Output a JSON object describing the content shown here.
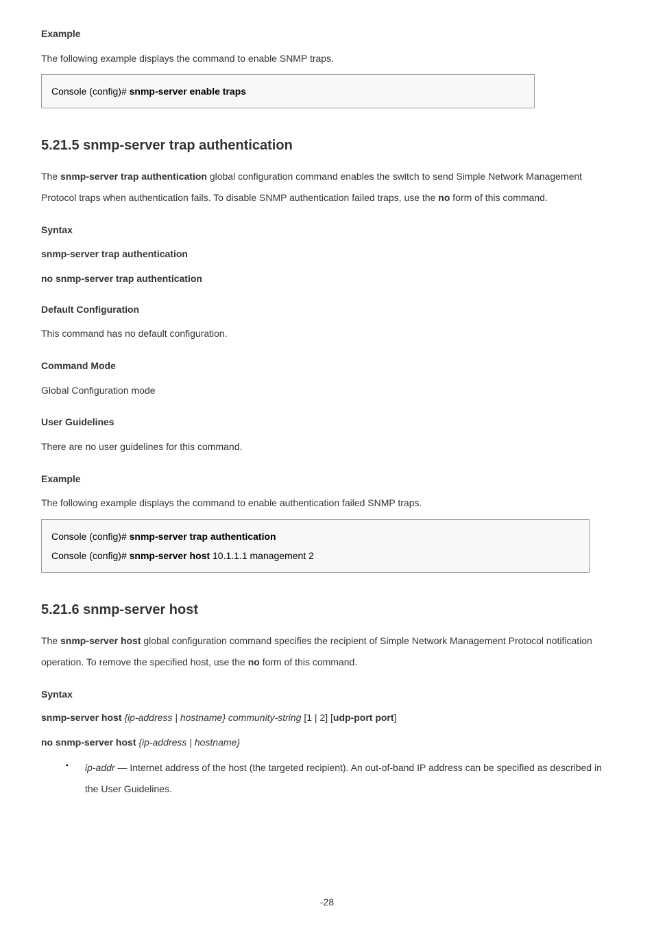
{
  "top": {
    "example_label": "Example",
    "example_intro": "The following example displays the command to enable SNMP traps.",
    "code1_prompt": "Console (config)# ",
    "code1_cmd": "snmp-server enable traps"
  },
  "sec2": {
    "heading": "5.21.5     snmp-server trap authentication",
    "desc_pre": "The ",
    "desc_cmd": "snmp-server trap authentication",
    "desc_post": " global configuration command enables the switch to send Simple Network Management Protocol traps when authentication fails. To disable SNMP authentication failed traps, use the ",
    "desc_no": "no",
    "desc_end": " form of this command.",
    "syntax_label": "Syntax",
    "syntax1": "snmp-server trap authentication",
    "syntax2": "no snmp-server trap authentication",
    "default_label": "Default Configuration",
    "default_text": "This command has no default configuration.",
    "mode_label": "Command Mode",
    "mode_text": "Global Configuration mode",
    "ug_label": "User Guidelines",
    "ug_text": "There are no user guidelines for this command.",
    "example_label": "Example",
    "example_intro": "The following example displays the command to enable authentication failed SNMP traps.",
    "code_prompt1": "Console (config)# ",
    "code_cmd1": "snmp-server trap authentication",
    "code_prompt2": "Console (config)# ",
    "code_cmd2a": "snmp-server host ",
    "code_cmd2b": "10.1.1.1 management 2"
  },
  "sec3": {
    "heading": "5.21.6     snmp-server host",
    "desc_pre": "The ",
    "desc_cmd": "snmp-server host",
    "desc_post": " global configuration command specifies the recipient of Simple Network Management Protocol notification operation. To remove the specified host, use the ",
    "desc_no": "no",
    "desc_end": " form of this command.",
    "syntax_label": "Syntax",
    "syntax1_a": "snmp-server host ",
    "syntax1_b": "{ip-address | hostname} community-string ",
    "syntax1_c": "[1 | 2] [",
    "syntax1_d": "udp-port port",
    "syntax1_e": "]",
    "syntax2_a": "no snmp-server host ",
    "syntax2_b": "{ip-address | hostname}",
    "bullet1_a": "ip-addr",
    "bullet1_b": " — Internet address of the host (the targeted recipient). An out-of-band IP address can be specified as described in the User Guidelines."
  },
  "page_number": "-28"
}
